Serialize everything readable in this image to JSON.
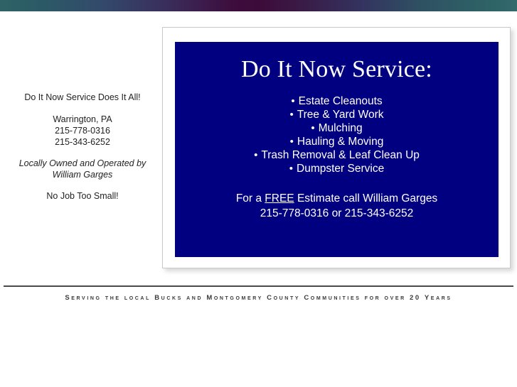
{
  "banner": {
    "gradient_left_color": "#2e6366",
    "gradient_center_color": "#3d0d3d",
    "gradient_right_color": "#2e6366"
  },
  "sidebar": {
    "tagline": "Do It Now Service Does It All!",
    "city_state": "Warrington, PA",
    "phone_1": "215-778-0316",
    "phone_2": "215-343-6252",
    "owned_line_1": "Locally Owned and Operated by",
    "owned_line_2": "William Garges",
    "slogan": "No Job Too Small!"
  },
  "panel": {
    "background_color": "#000080",
    "title": "Do It Now Service:",
    "bullet_glyph": "•",
    "services": [
      "Estate Cleanouts",
      "Tree & Yard Work",
      "Mulching",
      "Hauling & Moving",
      "Trash Removal & Leaf Clean Up",
      "Dumpster Service"
    ],
    "cta_prefix": "For a ",
    "cta_emphasis": "FREE",
    "cta_suffix": " Estimate call William Garges",
    "cta_phones": "215-778-0316 or 215-343-6252"
  },
  "footer": {
    "tagline": "Serving the local Bucks and Montgomery County Communities for over 20 Years"
  }
}
